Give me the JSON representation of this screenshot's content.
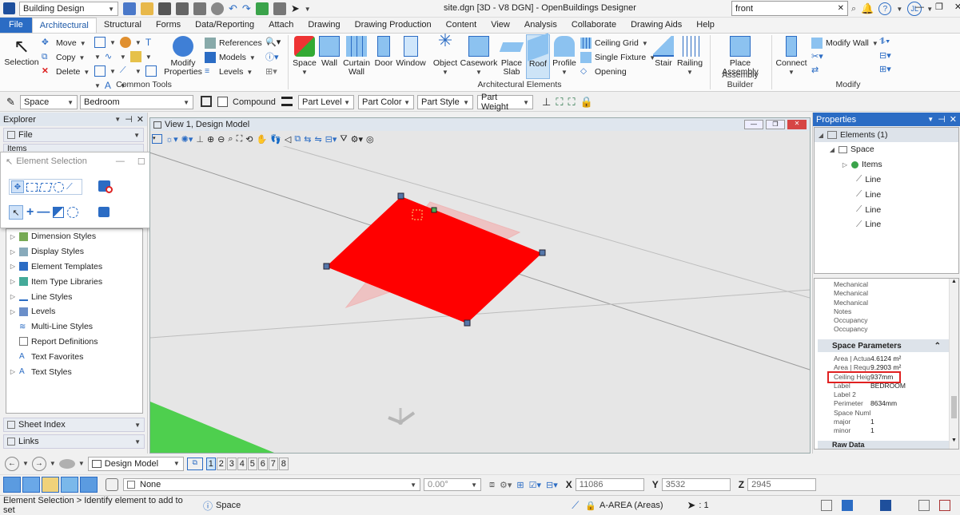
{
  "titlebar": {
    "workflow": "Building Design",
    "title": "site.dgn [3D - V8 DGN] - OpenBuildings Designer",
    "search_value": "front",
    "user_initials": "JL"
  },
  "tabs": [
    "File",
    "Architectural",
    "Structural",
    "Forms",
    "Data/Reporting",
    "Attach",
    "Drawing",
    "Drawing Production",
    "Content",
    "View",
    "Analysis",
    "Collaborate",
    "Drawing Aids",
    "Help"
  ],
  "ribbon": {
    "selection": "Selection",
    "move": "Move",
    "copy": "Copy",
    "delete": "Delete",
    "modify_properties": "Modify Properties",
    "references": "References",
    "models": "Models",
    "levels": "Levels",
    "common_tools": "Common Tools",
    "space": "Space",
    "wall": "Wall",
    "curtain_wall": "Curtain Wall",
    "door": "Door",
    "window": "Window",
    "object": "Object",
    "casework": "Casework",
    "place_slab": "Place Slab",
    "roof": "Roof",
    "profile": "Profile",
    "ceiling_grid": "Ceiling Grid",
    "single_fixture": "Single Fixture",
    "opening": "Opening",
    "stair": "Stair",
    "railing": "Railing",
    "arch_elements": "Architectural Elements",
    "place_assembly": "Place Assembly",
    "assembly_builder": "Assembly Builder",
    "connect": "Connect",
    "modify_wall": "Modify Wall",
    "modify": "Modify"
  },
  "attrbar": {
    "family": "Space",
    "part": "Bedroom",
    "compound": "Compound",
    "part_level": "Part Level",
    "part_color": "Part Color",
    "part_style": "Part Style",
    "part_weight": "Part Weight"
  },
  "explorer": {
    "title": "Explorer",
    "file": "File",
    "items": "Items",
    "tree": [
      "Dimension Styles",
      "Display Styles",
      "Element Templates",
      "Item Type Libraries",
      "Line Styles",
      "Levels",
      "Multi-Line Styles",
      "Report Definitions",
      "Text Favorites",
      "Text Styles"
    ],
    "sheet_index": "Sheet Index",
    "links": "Links"
  },
  "element_selection": {
    "title": "Element Selection"
  },
  "view": {
    "title": "View 1, Design Model"
  },
  "properties": {
    "title": "Properties",
    "tree": {
      "root": "Elements (1)",
      "space": "Space",
      "items": "Items",
      "lines": [
        "Line",
        "Line",
        "Line",
        "Line"
      ]
    },
    "upper_rows": [
      "Mechanical",
      "Mechanical",
      "Mechanical",
      "Notes",
      "Occupancy",
      "Occupancy"
    ],
    "section": "Space Parameters",
    "params": [
      {
        "k": "Area | Actua",
        "v": "4.6124 m²"
      },
      {
        "k": "Area | Requ",
        "v": "9.2903 m²"
      },
      {
        "k": "Ceiling Heig",
        "v": "937mm"
      },
      {
        "k": "Label",
        "v": "BEDROOM"
      },
      {
        "k": "Label 2",
        "v": ""
      },
      {
        "k": "Perimeter",
        "v": "8634mm"
      },
      {
        "k": "Space Numl",
        "v": ""
      },
      {
        "k": "major",
        "v": "1"
      },
      {
        "k": "minor",
        "v": "1"
      }
    ],
    "raw_data": "Raw Data"
  },
  "viewbar": {
    "model": "Design Model",
    "views": [
      "1",
      "2",
      "3",
      "4",
      "5",
      "6",
      "7",
      "8"
    ]
  },
  "coords": {
    "none": "None",
    "angle": "0.00°",
    "x_label": "X",
    "x": "11086",
    "y_label": "Y",
    "y": "3532",
    "z_label": "Z",
    "z": "2945"
  },
  "status": {
    "prompt": "Element Selection > Identify element to add to set",
    "type": "Space",
    "level": "A-AREA (Areas)",
    "count": ": 1"
  },
  "colors": {
    "accent": "#2b6cc4",
    "slab": "#ff0000",
    "highlight": "#e02020"
  }
}
